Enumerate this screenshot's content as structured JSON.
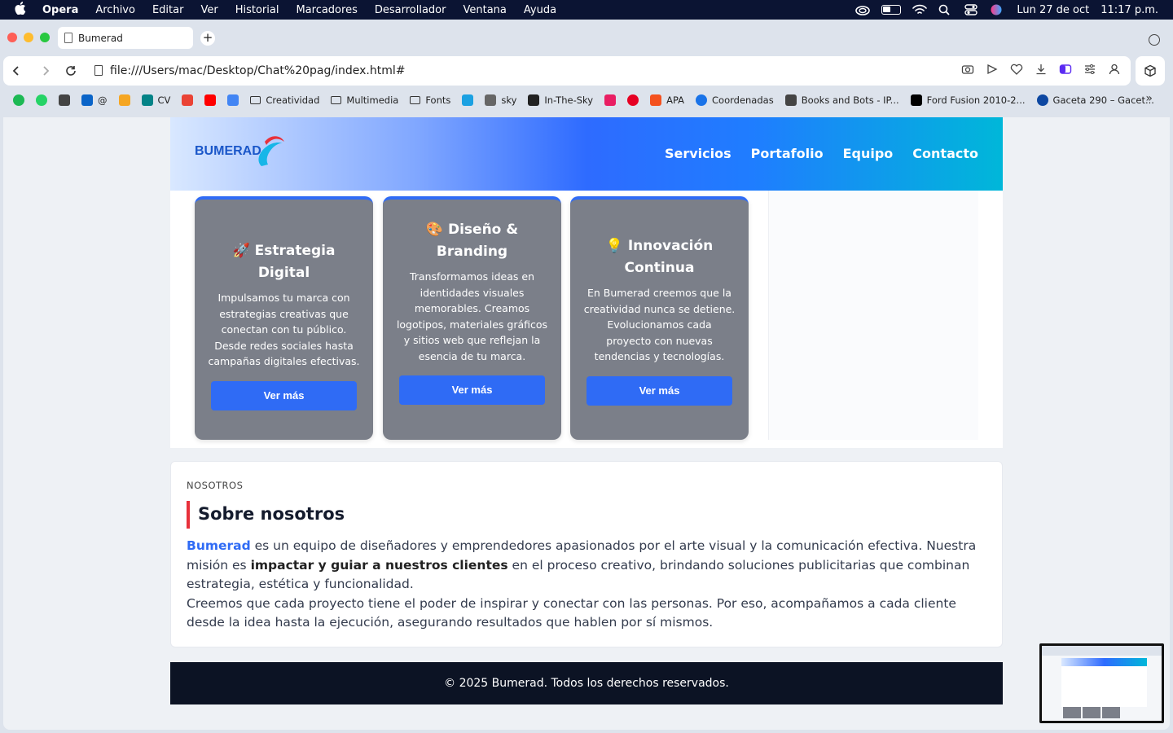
{
  "menubar": {
    "app": "Opera",
    "items": [
      "Archivo",
      "Editar",
      "Ver",
      "Historial",
      "Marcadores",
      "Desarrollador",
      "Ventana",
      "Ayuda"
    ],
    "date": "Lun 27 de oct",
    "time": "11:17 p.m."
  },
  "browser": {
    "tab_title": "Bumerad",
    "new_tab": "+",
    "url": "file:///Users/mac/Desktop/Chat%20pag/index.html#",
    "bookmarks": [
      {
        "label": "",
        "icon": "spotify-icon",
        "color": "#1db954"
      },
      {
        "label": "",
        "icon": "whatsapp-icon",
        "color": "#25d366"
      },
      {
        "label": "",
        "icon": "document-icon",
        "color": "#444444"
      },
      {
        "label": "@",
        "icon": "outlook-icon",
        "color": "#0a64c8"
      },
      {
        "label": "",
        "icon": "photos-icon",
        "color": "#f5a623"
      },
      {
        "label": "CV",
        "icon": "sharepoint-icon",
        "color": "#038387"
      },
      {
        "label": "",
        "icon": "gmail-icon",
        "color": "#ea4335"
      },
      {
        "label": "",
        "icon": "youtube-icon",
        "color": "#ff0000"
      },
      {
        "label": "",
        "icon": "translate-icon",
        "color": "#4285f4"
      },
      {
        "label": "Creatividad",
        "icon": "folder-icon",
        "color": ""
      },
      {
        "label": "Multimedia",
        "icon": "folder-icon",
        "color": ""
      },
      {
        "label": "Fonts",
        "icon": "folder-icon",
        "color": ""
      },
      {
        "label": "",
        "icon": "vpn-icon",
        "color": "#1ba1e2"
      },
      {
        "label": "sky",
        "icon": "speed-icon",
        "color": "#666666"
      },
      {
        "label": "In-The-Sky",
        "icon": "telescope-icon",
        "color": "#222222"
      },
      {
        "label": "",
        "icon": "colors-icon",
        "color": "#e91e63"
      },
      {
        "label": "",
        "icon": "pinterest-icon",
        "color": "#e60023"
      },
      {
        "label": "APA",
        "icon": "apa-icon",
        "color": "#f4511e"
      },
      {
        "label": "Coordenadas",
        "icon": "gps-icon",
        "color": "#1a73e8"
      },
      {
        "label": "Books and Bots - IP...",
        "icon": "document-icon",
        "color": "#444444"
      },
      {
        "label": "Ford Fusion 2010-2...",
        "icon": "csd-icon",
        "color": "#000000"
      },
      {
        "label": "Gaceta 290 – Gacet...",
        "icon": "gaceta-icon",
        "color": "#0d47a1"
      }
    ],
    "more": "»"
  },
  "site": {
    "logo_text": "BUMERAD",
    "nav": [
      "Servicios",
      "Portafolio",
      "Equipo",
      "Contacto"
    ],
    "cards": [
      {
        "emoji": "🚀",
        "title": "Estrategia Digital",
        "text": "Impulsamos tu marca con estrategias creativas que conectan con tu público. Desde redes sociales hasta campañas digitales efectivas.",
        "button": "Ver más"
      },
      {
        "emoji": "🎨",
        "title": "Diseño & Branding",
        "text": "Transformamos ideas en identidades visuales memorables. Creamos logotipos, materiales gráficos y sitios web que reflejan la esencia de tu marca.",
        "button": "Ver más"
      },
      {
        "emoji": "💡",
        "title": "Innovación Continua",
        "text": "En Bumerad creemos que la creatividad nunca se detiene. Evolucionamos cada proyecto con nuevas tendencias y tecnologías.",
        "button": "Ver más"
      }
    ],
    "about": {
      "kicker": "NOSOTROS",
      "title": "Sobre nosotros",
      "brand": "Bumerad",
      "p1_a": " es un equipo de diseñadores y emprendedores apasionados por el arte visual y la comunicación efectiva. Nuestra misión es ",
      "p1_strong": "impactar y guiar a nuestros clientes",
      "p1_b": " en el proceso creativo, brindando soluciones publicitarias que combinan estrategia, estética y funcionalidad.",
      "p2": "Creemos que cada proyecto tiene el poder de inspirar y conectar con las personas. Por eso, acompañamos a cada cliente desde la idea hasta la ejecución, asegurando resultados que hablen por sí mismos."
    },
    "footer": "© 2025 Bumerad. Todos los derechos reservados.",
    "colors": {
      "accent": "#2f6bf5",
      "card": "#7b7f89",
      "footer": "#0c1324",
      "title_bar": "#e8313b"
    }
  }
}
